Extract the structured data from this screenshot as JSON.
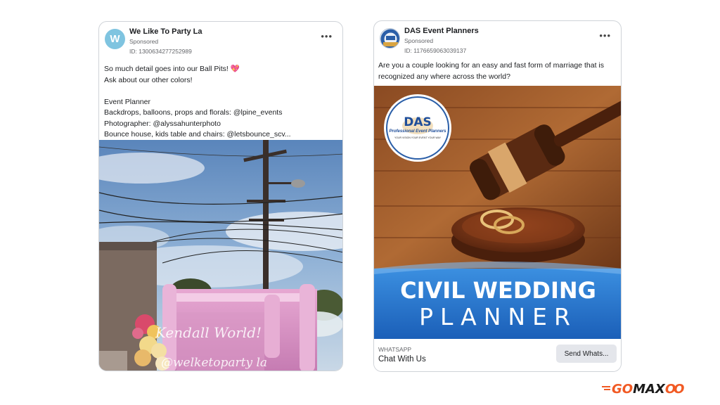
{
  "ads": [
    {
      "page_name": "We Like To Party La",
      "avatar_letter": "W",
      "sponsored": "Sponsored",
      "ad_id": "ID: 1300634277252989",
      "menu": "•••",
      "body_lines": [
        "So much detail goes into our Ball Pits! 💖",
        "Ask about our other colors!",
        "",
        "Event Planner",
        "Backdrops, balloons, props and florals: @lpine_events",
        "Photographer: @alyssahunterphoto",
        "Bounce house, kids table and chairs: @letsbounce_scv..."
      ],
      "media_overlay": [
        "Kendall World!",
        "@welketoparty la"
      ]
    },
    {
      "page_name": "DAS Event Planners",
      "sponsored": "Sponsored",
      "ad_id": "ID: 1176659063039137",
      "menu": "•••",
      "body_lines": [
        "Are you a couple looking for an easy and fast form of marriage that is",
        "recognized any where across the world?"
      ],
      "media": {
        "badge_title": "DAS",
        "badge_subtitle": "Professional Event Planners",
        "badge_tagline": "YOUR VISION YOUR EVENT YOUR WAY",
        "headline_1": "CIVIL WEDDING",
        "headline_2": "PLANNER"
      },
      "cta": {
        "source": "WHATSAPP",
        "title": "Chat With Us",
        "button": "Send Whats..."
      }
    }
  ],
  "brand": {
    "logo_go": "GO",
    "logo_max": "MAX",
    "logo_oo": "OO",
    "colors": {
      "orange": "#f15a24",
      "black": "#1a1a1a",
      "facebook_blue": "#1877f2"
    }
  }
}
